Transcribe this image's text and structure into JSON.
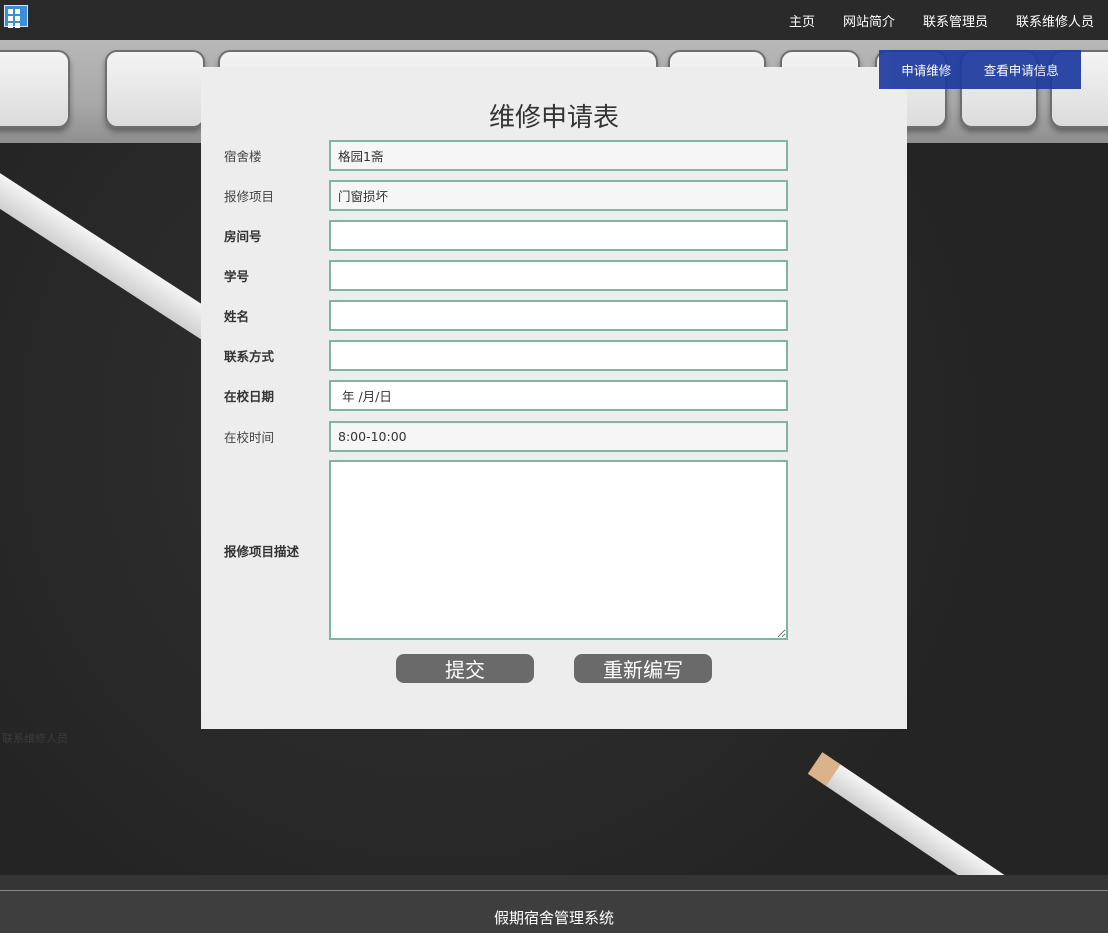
{
  "nav": {
    "items": [
      {
        "label": "主页"
      },
      {
        "label": "网站简介"
      },
      {
        "label": "联系管理员"
      },
      {
        "label": "联系维修人员"
      }
    ]
  },
  "subnav": {
    "items": [
      {
        "label": "申请维修"
      },
      {
        "label": "查看申请信息"
      }
    ]
  },
  "form": {
    "title": "维修申请表",
    "fields": [
      {
        "label": "宿舍楼",
        "value": "格园1斋"
      },
      {
        "label": "报修项目",
        "value": "门窗损坏"
      },
      {
        "label": "房间号",
        "value": ""
      },
      {
        "label": "学号",
        "value": ""
      },
      {
        "label": "姓名",
        "value": ""
      },
      {
        "label": "联系方式",
        "value": ""
      },
      {
        "label": "在校日期",
        "value": "年 /月/日"
      },
      {
        "label": "在校时间",
        "value": "8:00-10:00"
      },
      {
        "label": "报修项目描述",
        "value": ""
      }
    ],
    "submit_label": "提交",
    "reset_label": "重新编写"
  },
  "background": {
    "faint_text": "联系维修人员"
  },
  "footer": {
    "text": "假期宿舍管理系统"
  },
  "colors": {
    "nav_bg": "#2a2a2a",
    "subnav_bg": "#1f3c9f",
    "panel_bg": "#ededed",
    "field_border": "#7fb5a2",
    "button_bg": "#6a6a6a",
    "footer_bg": "#3e3e3e"
  }
}
